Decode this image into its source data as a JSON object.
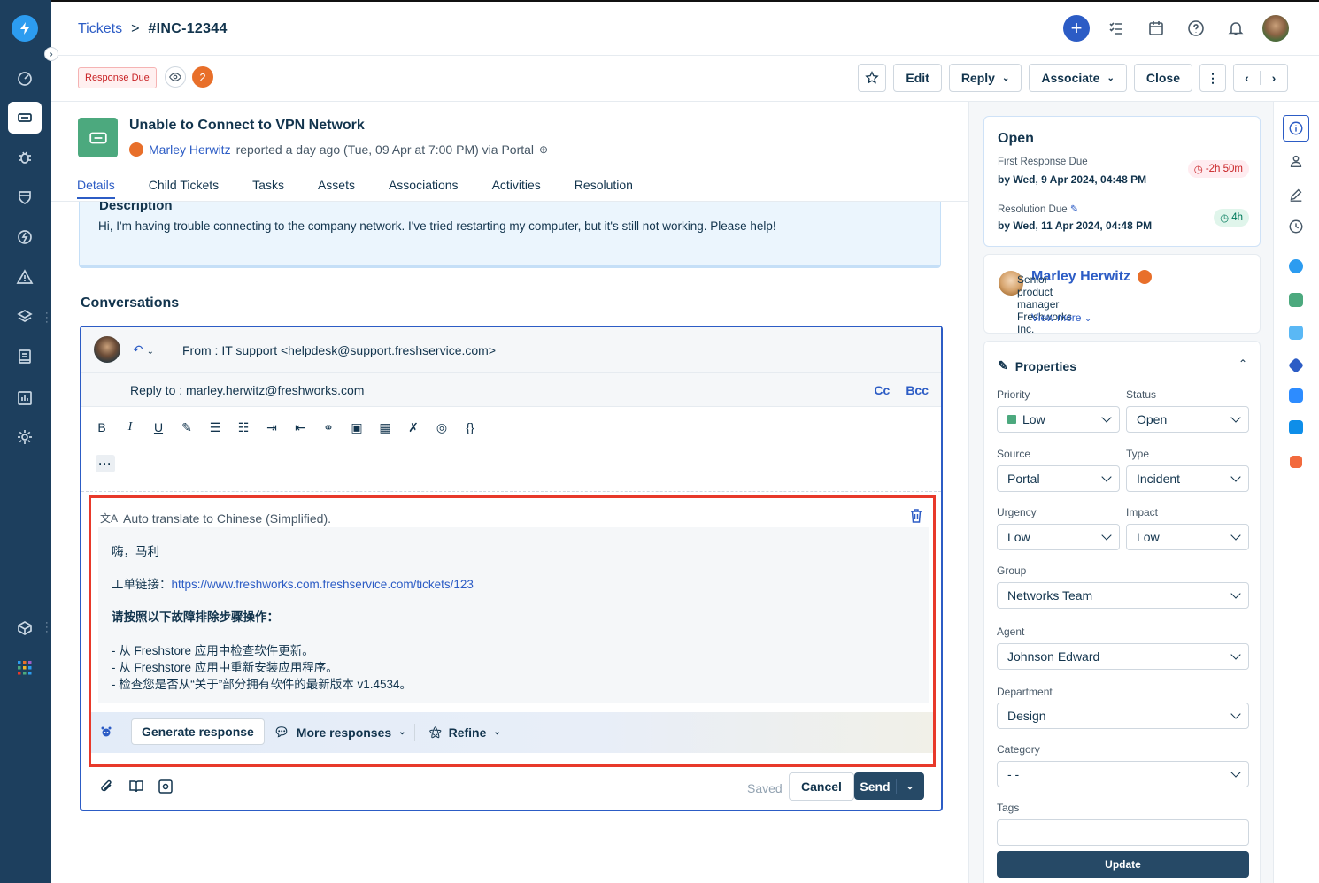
{
  "breadcrumb": {
    "root": "Tickets",
    "sep": ">",
    "current": "#INC-12344"
  },
  "status_badge": "Response Due",
  "watcher_count": "2",
  "actions": {
    "edit": "Edit",
    "reply": "Reply",
    "associate": "Associate",
    "close": "Close"
  },
  "ticket": {
    "title": "Unable to Connect to VPN Network",
    "requester": "Marley Herwitz",
    "reported": "reported a day ago (Tue, 09 Apr at 7:00 PM) via Portal"
  },
  "tabs": [
    "Details",
    "Child Tickets",
    "Tasks",
    "Assets",
    "Associations",
    "Activities",
    "Resolution"
  ],
  "description": {
    "heading": "Description",
    "text": "Hi, I'm having trouble connecting to the company network. I've tried restarting my computer, but it's still not working. Please help!"
  },
  "conversations_heading": "Conversations",
  "editor": {
    "from": "From : IT support <helpdesk@support.freshservice.com>",
    "reply_to_label": "Reply to : ",
    "reply_to": "marley.herwitz@freshworks.com",
    "cc": "Cc",
    "bcc": "Bcc",
    "translate_label": "Auto translate to Chinese (Simplified).",
    "greeting": "嗨，马利",
    "link_label": "工单链接：",
    "link": "https://www.freshworks.com.freshservice.com/tickets/123",
    "steps_heading": "请按照以下故障排除步骤操作：",
    "steps": [
      "- 从 Freshstore 应用中检查软件更新。",
      "- 从 Freshstore 应用中重新安装应用程序。",
      "- 检查您是否从“关于”部分拥有软件的最新版本 v1.4534。"
    ],
    "generate": "Generate response",
    "more_responses": "More responses",
    "refine": "Refine",
    "saved": "Saved",
    "cancel": "Cancel",
    "send": "Send"
  },
  "sla": {
    "status": "Open",
    "first_response_label": "First Response Due",
    "first_response_value": "by Wed, 9 Apr 2024, 04:48 PM",
    "first_response_pill": "-2h 50m",
    "resolution_label": "Resolution Due",
    "resolution_value": "by Wed, 11 Apr 2024, 04:48 PM",
    "resolution_pill": "4h"
  },
  "requester_card": {
    "name": "Marley Herwitz",
    "role": "Senior product manager Freshworks Inc.",
    "view_more": "View more"
  },
  "properties": {
    "heading": "Properties",
    "priority_label": "Priority",
    "priority": "Low",
    "status_label": "Status",
    "status": "Open",
    "source_label": "Source",
    "source": "Portal",
    "type_label": "Type",
    "type": "Incident",
    "urgency_label": "Urgency",
    "urgency": "Low",
    "impact_label": "Impact",
    "impact": "Low",
    "group_label": "Group",
    "group": "Networks Team",
    "agent_label": "Agent",
    "agent": "Johnson Edward",
    "department_label": "Department",
    "department": "Design",
    "category_label": "Category",
    "category": "- -",
    "tags_label": "Tags",
    "update": "Update"
  },
  "colors": {
    "nav": "#1d3f5e",
    "accent": "#2c5cc5",
    "highlight": "#e8392a",
    "priority_low": "#4ca97e"
  }
}
